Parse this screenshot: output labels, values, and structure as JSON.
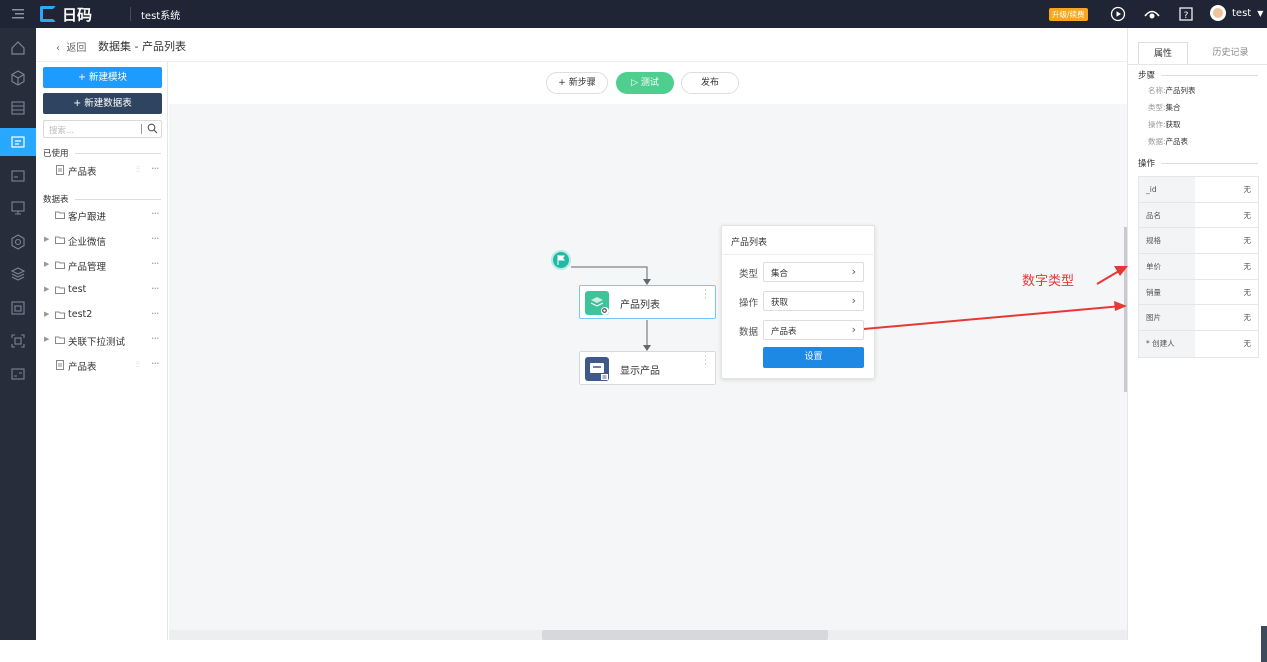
{
  "topbar": {
    "brand": "日码",
    "system_name": "test系统",
    "upgrade_label": "升级/续费",
    "user_name": "test"
  },
  "breadcrumb": {
    "back_label": "返回",
    "title": "数据集 - 产品列表"
  },
  "sidebar": {
    "new_module_label": "+ 新建模块",
    "new_table_label": "+ 新建数据表",
    "search_placeholder": "搜索...",
    "used_section": "已使用",
    "used_items": [
      {
        "label": "产品表"
      }
    ],
    "tables_section": "数据表",
    "table_items": [
      {
        "label": "客户跟进"
      },
      {
        "label": "企业微信"
      },
      {
        "label": "产品管理"
      },
      {
        "label": "test"
      },
      {
        "label": "test2"
      },
      {
        "label": "关联下拉测试"
      },
      {
        "label": "产品表"
      }
    ]
  },
  "canvas_toolbar": {
    "new_step_label": "+ 新步骤",
    "test_label": "▷ 测试",
    "publish_label": "发布"
  },
  "flow": {
    "nodes": [
      {
        "label": "产品列表"
      },
      {
        "label": "显示产品"
      }
    ]
  },
  "popover": {
    "title": "产品列表",
    "rows": [
      {
        "label": "类型",
        "value": "集合"
      },
      {
        "label": "操作",
        "value": "获取"
      },
      {
        "label": "数据",
        "value": "产品表"
      }
    ],
    "button_label": "设置"
  },
  "right_panel": {
    "tabs": [
      "属性",
      "历史记录"
    ],
    "step_section": "步骤",
    "step_props": [
      {
        "key": "名称:",
        "value": "产品列表"
      },
      {
        "key": "类型:",
        "value": "集合"
      },
      {
        "key": "操作:",
        "value": "获取"
      },
      {
        "key": "数据:",
        "value": "产品表"
      }
    ],
    "ops_section": "操作",
    "fields": [
      {
        "name": "_id",
        "value": "无"
      },
      {
        "name": "品名",
        "value": "无"
      },
      {
        "name": "规格",
        "value": "无"
      },
      {
        "name": "单价",
        "value": "无"
      },
      {
        "name": "销量",
        "value": "无"
      },
      {
        "name": "图片",
        "value": "无"
      },
      {
        "name": "* 创建人",
        "value": "无"
      }
    ]
  },
  "annotation": {
    "text": "数字类型",
    "color": "#e53935"
  }
}
